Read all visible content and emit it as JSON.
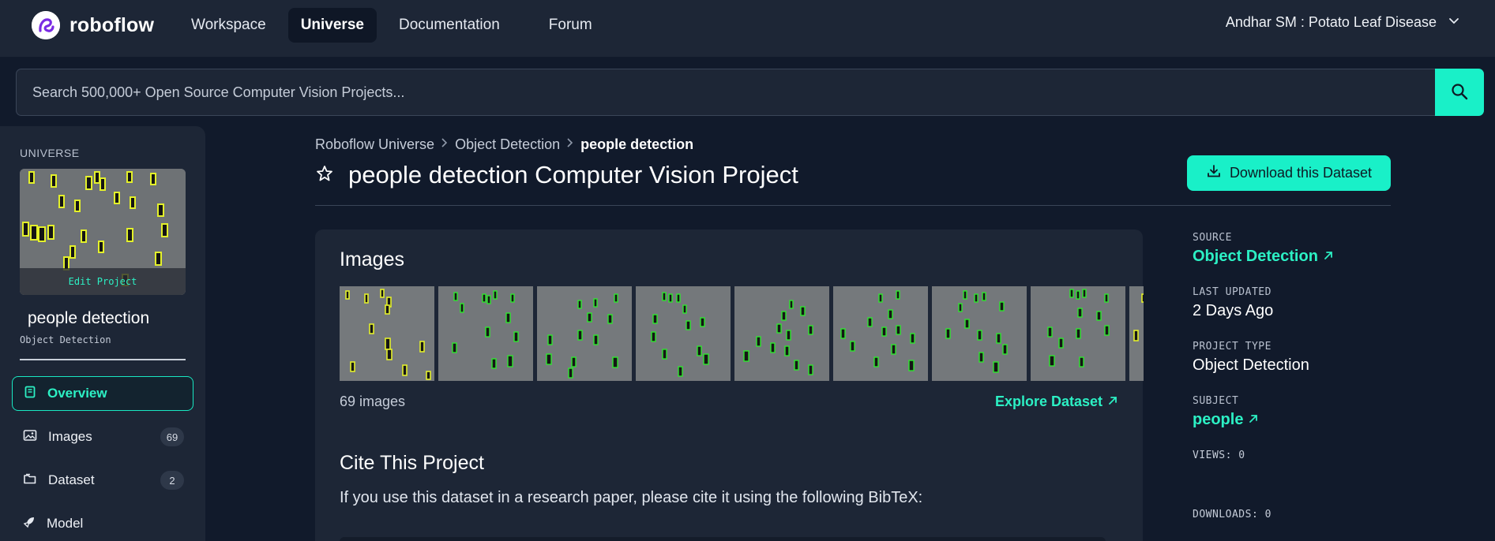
{
  "header": {
    "brand": "roboflow",
    "nav": [
      {
        "label": "Workspace"
      },
      {
        "label": "Universe"
      },
      {
        "label": "Documentation"
      },
      {
        "label": "Forum"
      }
    ],
    "workspace_menu": "Andhar SM : Potato Leaf Disease"
  },
  "search": {
    "placeholder": "Search 500,000+ Open Source Computer Vision Projects..."
  },
  "sidebar": {
    "section_label": "UNIVERSE",
    "edit_label": "Edit Project",
    "project_name": "people detection",
    "project_type": "Object Detection",
    "items": [
      {
        "label": "Overview",
        "icon": "book-icon"
      },
      {
        "label": "Images",
        "icon": "image-icon",
        "count": "69"
      },
      {
        "label": "Dataset",
        "icon": "folder-icon",
        "count": "2"
      },
      {
        "label": "Model",
        "icon": "rocket-icon"
      }
    ]
  },
  "breadcrumb": [
    "Roboflow Universe",
    "Object Detection",
    "people detection"
  ],
  "page_title": "people detection Computer Vision Project",
  "download_label": "Download this Dataset",
  "images_card": {
    "heading": "Images",
    "count_text": "69 images",
    "explore_label": "Explore Dataset"
  },
  "cite": {
    "heading": "Cite This Project",
    "text": "If you use this dataset in a research paper, please cite it using the following BibTeX:"
  },
  "meta": {
    "source_label": "SOURCE",
    "source_value": "Object Detection",
    "updated_label": "LAST UPDATED",
    "updated_value": "2 Days Ago",
    "type_label": "PROJECT TYPE",
    "type_value": "Object Detection",
    "subject_label": "SUBJECT",
    "subject_value": "people",
    "views_text": "VIEWS: 0",
    "downloads_text": "DOWNLOADS: 0"
  },
  "colors": {
    "accent": "#19f0c8",
    "background": "#111a2b",
    "panel": "#1d2636",
    "box_yellow": "#e3f02a",
    "box_green": "#2ee82e"
  }
}
